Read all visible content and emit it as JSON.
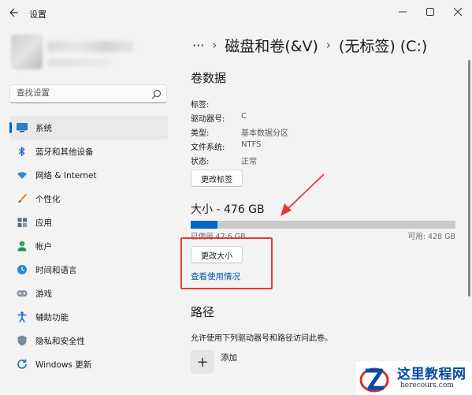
{
  "window": {
    "app_title": "设置"
  },
  "search": {
    "placeholder": "查找设置"
  },
  "sidebar": {
    "items": [
      {
        "label": "系统",
        "icon": "monitor-icon",
        "active": true
      },
      {
        "label": "蓝牙和其他设备",
        "icon": "bluetooth-icon",
        "active": false
      },
      {
        "label": "网络 & Internet",
        "icon": "wifi-icon",
        "active": false
      },
      {
        "label": "个性化",
        "icon": "brush-icon",
        "active": false
      },
      {
        "label": "应用",
        "icon": "apps-icon",
        "active": false
      },
      {
        "label": "帐户",
        "icon": "person-icon",
        "active": false
      },
      {
        "label": "时间和语言",
        "icon": "globe-clock-icon",
        "active": false
      },
      {
        "label": "游戏",
        "icon": "gamepad-icon",
        "active": false
      },
      {
        "label": "辅助功能",
        "icon": "accessibility-icon",
        "active": false
      },
      {
        "label": "隐私和安全性",
        "icon": "shield-icon",
        "active": false
      },
      {
        "label": "Windows 更新",
        "icon": "update-icon",
        "active": false
      }
    ]
  },
  "breadcrumb": {
    "ellipsis": "···",
    "parent": "磁盘和卷(&V)",
    "current": "(无标签) (C:)"
  },
  "volume": {
    "section_title": "卷数据",
    "properties": [
      {
        "label": "标签:",
        "value": ""
      },
      {
        "label": "驱动器号:",
        "value": "C"
      },
      {
        "label": "类型:",
        "value": "基本数据分区"
      },
      {
        "label": "文件系统:",
        "value": "NTFS"
      },
      {
        "label": "状态:",
        "value": "正常"
      }
    ],
    "change_label_button": "更改标签"
  },
  "size": {
    "title": "大小 - 476 GB",
    "used_fraction": 0.1,
    "used_text": "已使用 47.6 GB",
    "free_text": "可用: 428 GB",
    "resize_button": "更改大小",
    "usage_link": "查看使用情况"
  },
  "path": {
    "section_title": "路径",
    "description": "允许使用下列驱动器号和路径访问此卷。",
    "add_label": "添加"
  },
  "watermark": {
    "title": "这里教程网",
    "subtitle": "herecours.com"
  },
  "colors": {
    "accent": "#0067c0",
    "annotation": "#e53935"
  }
}
